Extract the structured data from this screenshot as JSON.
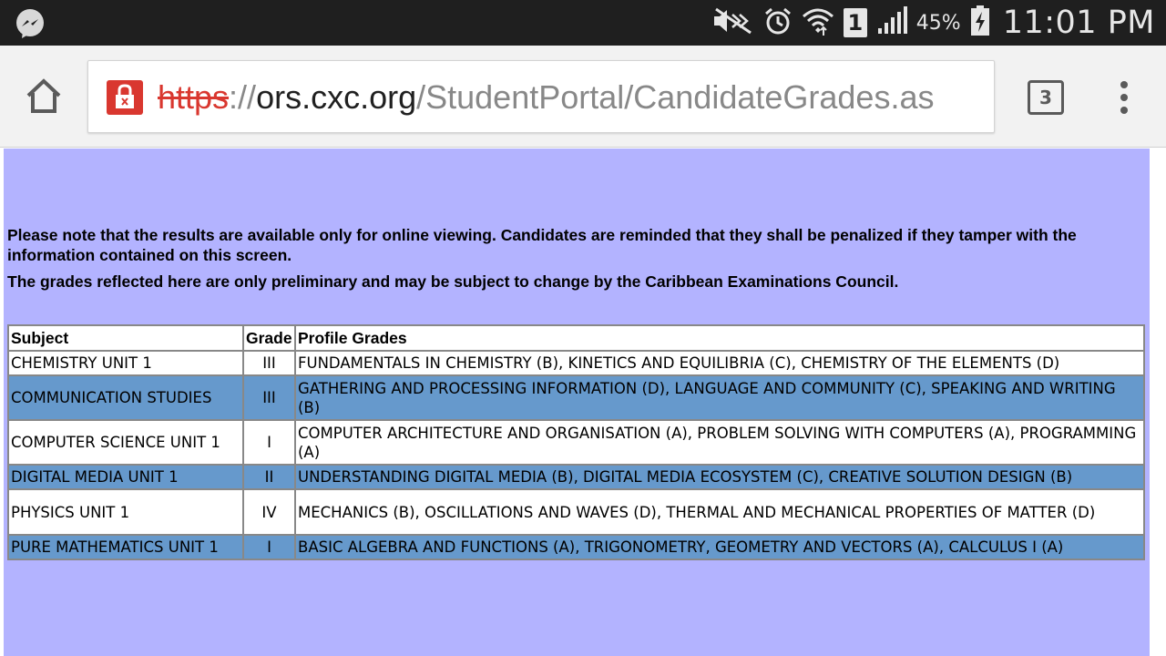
{
  "status_bar": {
    "battery_percent": "45%",
    "time": "11:01 PM",
    "sim_slot": "1",
    "icons": [
      "messenger-icon",
      "mute-icon",
      "alarm-icon",
      "wifi-icon",
      "signal-icon",
      "battery-charging-icon"
    ]
  },
  "browser": {
    "url": {
      "scheme": "https",
      "separator": "://",
      "host": "ors.cxc.org",
      "path": "/StudentPortal/CandidateGrades.as"
    },
    "tab_count": "3",
    "icons": [
      "home-icon",
      "lock-error-icon",
      "tabs-icon",
      "overflow-menu-icon"
    ]
  },
  "page": {
    "notice_1": "Please note that the results are available only for online viewing. Candidates are reminded that they shall be penalized if they tamper with the information contained on this screen.",
    "notice_2": "The grades reflected here are only preliminary and may be subject to change by the Caribbean Examinations Council.",
    "table": {
      "headers": {
        "subject": "Subject",
        "grade": "Grade",
        "profile": "Profile Grades"
      },
      "rows": [
        {
          "subject": "CHEMISTRY UNIT 1",
          "grade": "III",
          "profile": "FUNDAMENTALS IN CHEMISTRY (B), KINETICS AND EQUILIBRIA (C), CHEMISTRY OF THE ELEMENTS (D)"
        },
        {
          "subject": "COMMUNICATION STUDIES",
          "grade": "III",
          "profile": "GATHERING AND PROCESSING INFORMATION (D), LANGUAGE AND COMMUNITY (C), SPEAKING AND WRITING (B)"
        },
        {
          "subject": "COMPUTER SCIENCE UNIT 1",
          "grade": "I",
          "profile": "COMPUTER ARCHITECTURE AND ORGANISATION (A), PROBLEM SOLVING WITH COMPUTERS (A), PROGRAMMING (A)"
        },
        {
          "subject": "DIGITAL MEDIA UNIT 1",
          "grade": "II",
          "profile": "UNDERSTANDING DIGITAL MEDIA (B), DIGITAL MEDIA ECOSYSTEM (C), CREATIVE SOLUTION DESIGN (B)"
        },
        {
          "subject": "PHYSICS UNIT 1",
          "grade": "IV",
          "profile": "MECHANICS (B), OSCILLATIONS AND WAVES (D), THERMAL AND MECHANICAL PROPERTIES OF MATTER (D)"
        },
        {
          "subject": "PURE MATHEMATICS UNIT 1",
          "grade": "I",
          "profile": "BASIC ALGEBRA AND FUNCTIONS (A), TRIGONOMETRY, GEOMETRY AND VECTORS (A), CALCULUS I (A)"
        }
      ]
    }
  },
  "colors": {
    "page_background": "#b3b3ff",
    "alt_row": "#6699cc",
    "status_bar": "#1f1f1f",
    "insecure_scheme": "#d9372f"
  }
}
